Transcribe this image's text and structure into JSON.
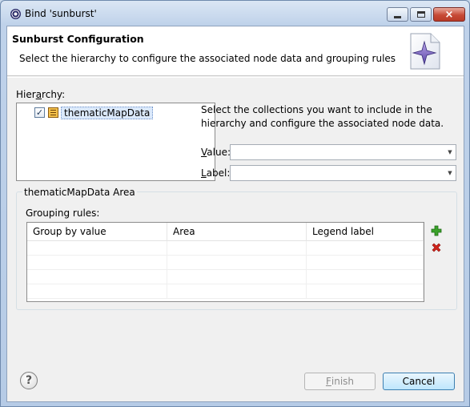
{
  "window": {
    "title": "Bind 'sunburst'",
    "close_glyph": "×"
  },
  "banner": {
    "title": "Sunburst Configuration",
    "description": "Select the hierarchy to configure the associated node data and grouping rules"
  },
  "hierarchy": {
    "label_pre": "Hier",
    "label_mnemonic": "a",
    "label_post": "rchy:",
    "items": [
      {
        "label": "thematicMapData",
        "checked": true,
        "check_glyph": "✓"
      }
    ]
  },
  "instructions": "Select the collections you want to include in the hierarchy and configure the associated node data.",
  "fields": {
    "value": {
      "mnemonic": "V",
      "rest": "alue:",
      "selected": ""
    },
    "label": {
      "mnemonic": "L",
      "rest": "abel:",
      "selected": ""
    }
  },
  "area_group": {
    "title": "thematicMapData Area",
    "grouping_label": "Grouping rules:",
    "columns": [
      "Group by value",
      "Area",
      "Legend label"
    ],
    "rows": []
  },
  "buttons": {
    "help": "?",
    "finish_mnemonic": "F",
    "finish_rest": "inish",
    "cancel": "Cancel"
  },
  "colors": {
    "accent": "#3c7fb1",
    "add": "#3aa12a",
    "delete": "#d1231b"
  },
  "icons": [
    "app-icon",
    "wizard-icon",
    "table-node-icon",
    "add-icon",
    "delete-icon",
    "help-icon",
    "dropdown-arrow-icon"
  ]
}
